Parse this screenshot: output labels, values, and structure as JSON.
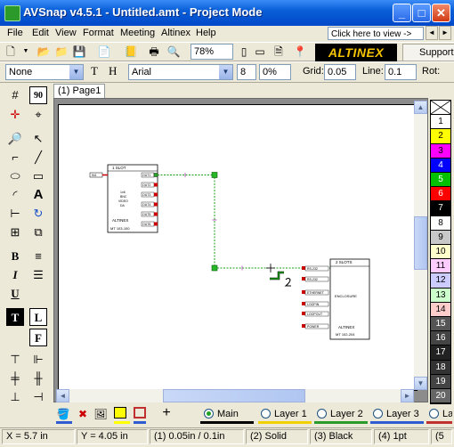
{
  "window": {
    "title": "AVSnap v4.5.1 - Untitled.amt  - Project Mode"
  },
  "menu": {
    "items": [
      "File",
      "Edit",
      "View",
      "Format",
      "Meeting",
      "Altinex",
      "Help"
    ],
    "link_text": "Click here to view ->"
  },
  "toolbar1": {
    "zoom": "78%",
    "brand": "ALTINEX",
    "support": "Support"
  },
  "toolbar2": {
    "style_select": "None",
    "t_label": "T",
    "h_label": "H",
    "font_select": "Arial",
    "font_size": "8",
    "spacing": "0%",
    "grid_label": "Grid:",
    "grid_value": "0.05",
    "line_label": "Line:",
    "line_value": "0.1",
    "rot_label": "Rot:"
  },
  "tabs": [
    {
      "label": "(1) Page1"
    }
  ],
  "devices": {
    "dev1": {
      "title": "1 SLOT",
      "input_label": "IN1",
      "outputs": [
        "OUT1",
        "OUT2",
        "OUT3",
        "OUT4",
        "OUT5",
        "OUT6"
      ],
      "center_lines": [
        "1x6",
        "BNC",
        "VIDEO",
        "DA"
      ],
      "brand": "ALTINEX",
      "model": "MT 103-100"
    },
    "dev2": {
      "title": "2 SLOTS",
      "ports": [
        "RS-232",
        "RS-232",
        "ETHERNET",
        "LOOPIN",
        "LOOPOUT",
        "POWER"
      ],
      "center": "ENCLOSURE",
      "brand": "ALTINEX",
      "model": "MT 102-204"
    }
  },
  "palette": {
    "swatches": [
      {
        "label": "",
        "color": "#ffffff"
      },
      {
        "label": "1",
        "color": "#ffffff"
      },
      {
        "label": "2",
        "color": "#ffff00"
      },
      {
        "label": "3",
        "color": "#ff00ff"
      },
      {
        "label": "4",
        "color": "#0000ff"
      },
      {
        "label": "5",
        "color": "#00c000"
      },
      {
        "label": "6",
        "color": "#ff0000"
      },
      {
        "label": "7",
        "color": "#000000"
      },
      {
        "label": "8",
        "color": "#ffffff"
      },
      {
        "label": "9",
        "color": "#c8c8c8"
      },
      {
        "label": "10",
        "color": "#ffffcc"
      },
      {
        "label": "11",
        "color": "#ffccff"
      },
      {
        "label": "12",
        "color": "#ccccff"
      },
      {
        "label": "13",
        "color": "#ccffcc"
      },
      {
        "label": "14",
        "color": "#ffcccc"
      },
      {
        "label": "15",
        "color": "#555555"
      },
      {
        "label": "16",
        "color": "#444444"
      },
      {
        "label": "17",
        "color": "#222222"
      },
      {
        "label": "18",
        "color": "#333333"
      },
      {
        "label": "19",
        "color": "#444444"
      },
      {
        "label": "20",
        "color": "#666666"
      }
    ]
  },
  "layers": {
    "main": "Main",
    "layer1": "Layer 1",
    "layer2": "Layer 2",
    "layer3": "Layer 3",
    "layer4": "La"
  },
  "status": {
    "x": "X = 5.7 in",
    "y": "Y = 4.05 in",
    "grid": "(1) 0.05in / 0.1in",
    "line": "(2) Solid",
    "color": "(3) Black",
    "width": "(4) 1pt",
    "extra": "(5"
  },
  "colors": {
    "line_green": "#19a019",
    "node_green": "#27b827",
    "accent": "#0a5fd8",
    "brand_yellow": "#f5c400"
  }
}
